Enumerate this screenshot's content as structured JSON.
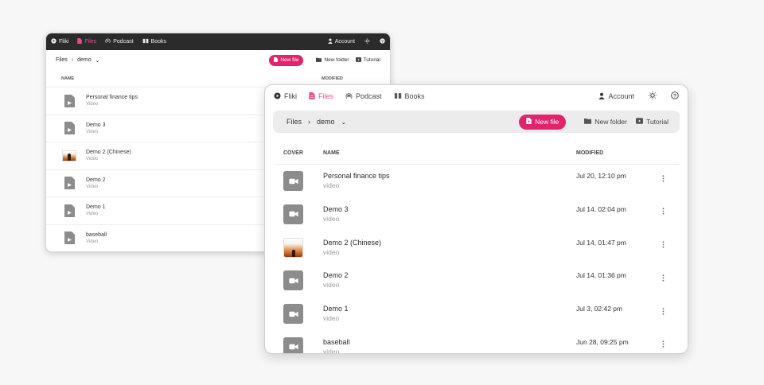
{
  "nav": {
    "brand": "Fliki",
    "files": "Files",
    "podcast": "Podcast",
    "books": "Books",
    "account": "Account"
  },
  "toolbar": {
    "crumb_root": "Files",
    "crumb_current": "demo",
    "new_file": "New file",
    "new_folder": "New folder",
    "tutorial": "Tutorial"
  },
  "table": {
    "col_cover": "COVER",
    "col_name": "NAME",
    "col_modified": "MODIFIED"
  },
  "rows": [
    {
      "title": "Personal finance tips",
      "type": "video",
      "modified": "Jul 20, 12:10 pm",
      "thumb": "video-icon"
    },
    {
      "title": "Demo 3",
      "type": "video",
      "modified": "Jul 14, 02:04 pm",
      "thumb": "video-icon"
    },
    {
      "title": "Demo 2 (Chinese)",
      "type": "video",
      "modified": "Jul 14, 01:47 pm",
      "thumb": "photo"
    },
    {
      "title": "Demo 2",
      "type": "video",
      "modified": "Jul 14, 01:36 pm",
      "thumb": "video-icon"
    },
    {
      "title": "Demo 1",
      "type": "video",
      "modified": "Jul 3, 02:42 pm",
      "thumb": "video-icon"
    },
    {
      "title": "baseball",
      "type": "video",
      "modified": "Jun 28, 09:25 pm",
      "thumb": "video-icon"
    }
  ],
  "back_rows": [
    {
      "title": "Personal finance tips",
      "type": "Video"
    },
    {
      "title": "Demo 3",
      "type": "Video"
    },
    {
      "title": "Demo 2 (Chinese)",
      "type": "Video"
    },
    {
      "title": "Demo 2",
      "type": "Video"
    },
    {
      "title": "Demo 1",
      "type": "Video"
    },
    {
      "title": "baseball",
      "type": "Video"
    }
  ],
  "colors": {
    "accent": "#e0246e",
    "nav_dark": "#2b2b2b",
    "active_nav": "#e24f8f",
    "thumb_gray": "#8c8c8c"
  }
}
